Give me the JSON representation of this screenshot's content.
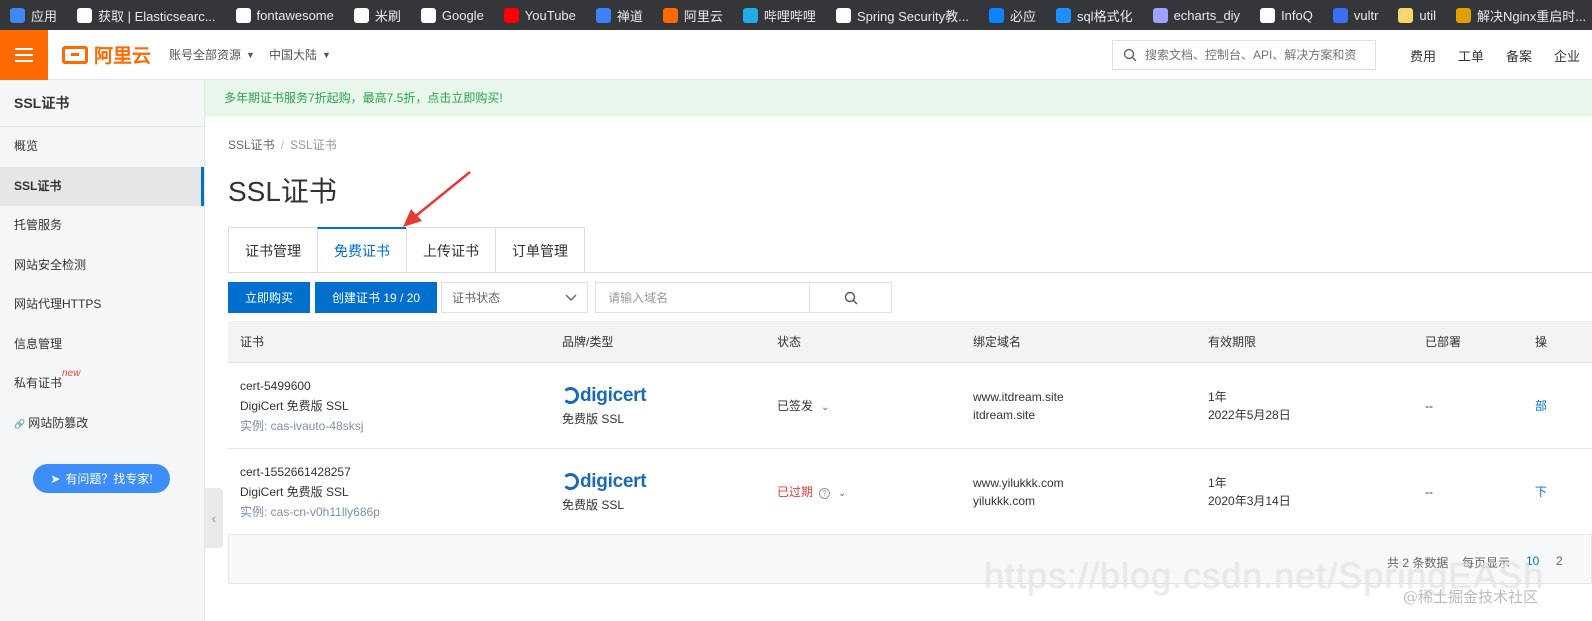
{
  "bookmarks": [
    {
      "label": "应用",
      "color": "#4285f4",
      "icon": "apps-grid-icon"
    },
    {
      "label": "获取 | Elasticsearc...",
      "color": "#ffffff",
      "icon": "elastic-icon"
    },
    {
      "label": "fontawesome",
      "color": "#ffffff",
      "icon": "globe-icon"
    },
    {
      "label": "米刷",
      "color": "#ffffff",
      "icon": "globe-icon"
    },
    {
      "label": "Google",
      "color": "#ffffff",
      "icon": "google-icon"
    },
    {
      "label": "YouTube",
      "color": "#ff0000",
      "icon": "youtube-icon"
    },
    {
      "label": "禅道",
      "color": "#3b82f6",
      "icon": "zentao-icon"
    },
    {
      "label": "阿里云",
      "color": "#ff6a00",
      "icon": "aliyun-icon"
    },
    {
      "label": "哔哩哔哩",
      "color": "#23ade5",
      "icon": "bilibili-icon"
    },
    {
      "label": "Spring Security教...",
      "color": "#ffffff",
      "icon": "bold-b-icon"
    },
    {
      "label": "必应",
      "color": "#0a84ff",
      "icon": "bing-icon"
    },
    {
      "label": "sql格式化",
      "color": "#1e90ff",
      "icon": "c-icon"
    },
    {
      "label": "echarts_diy",
      "color": "#a0a0ff",
      "icon": "echarts-icon"
    },
    {
      "label": "InfoQ",
      "color": "#ffffff",
      "icon": "infoq-icon"
    },
    {
      "label": "vultr",
      "color": "#3b6ef5",
      "icon": "vultr-icon"
    },
    {
      "label": "util",
      "color": "#f5d76e",
      "icon": "folder-icon"
    },
    {
      "label": "解决Nginx重启时...",
      "color": "#e0a000",
      "icon": "snail-icon"
    }
  ],
  "topbar": {
    "logo_text": "阿里云",
    "account_dd": "账号全部资源",
    "region_dd": "中国大陆",
    "search_placeholder": "搜索文档、控制台、API、解决方案和资",
    "links": [
      "费用",
      "工单",
      "备案",
      "企业"
    ]
  },
  "sidebar": {
    "title": "SSL证书",
    "items": [
      {
        "label": "概览"
      },
      {
        "label": "SSL证书",
        "active": true
      },
      {
        "label": "托管服务"
      },
      {
        "label": "网站安全检测"
      },
      {
        "label": "网站代理HTTPS"
      },
      {
        "label": "信息管理"
      },
      {
        "label": "私有证书",
        "tag": "new"
      },
      {
        "label": "网站防篡改"
      }
    ],
    "expert_button": "有问题？找专家!"
  },
  "promo_text": "多年期证书服务7折起购，最高7.5折，点击立即购买!",
  "breadcrumb": [
    "SSL证书",
    "SSL证书"
  ],
  "page_title": "SSL证书",
  "tabs": [
    "证书管理",
    "免费证书",
    "上传证书",
    "订单管理"
  ],
  "toolbar": {
    "buy_label": "立即购买",
    "create_label": "创建证书 19 / 20",
    "status_placeholder": "证书状态",
    "domain_placeholder": "请输入域名"
  },
  "table": {
    "columns": [
      "证书",
      "品牌/类型",
      "状态",
      "绑定域名",
      "有效期限",
      "已部署",
      "操"
    ],
    "rows": [
      {
        "name": "cert-5499600",
        "product": "DigiCert 免费版 SSL",
        "instance": "实例: cas-ivauto-48sksj",
        "brand": "digicert",
        "type": "免费版 SSL",
        "status": "已签发",
        "domains": [
          "www.itdream.site",
          "itdream.site"
        ],
        "period": "1年",
        "expiry": "2022年5月28日",
        "deployed": "--",
        "action": "部"
      },
      {
        "name": "cert-1552661428257",
        "product": "DigiCert 免费版 SSL",
        "instance": "实例: cas-cn-v0h11lly686p",
        "brand": "digicert",
        "type": "免费版 SSL",
        "status": "已过期",
        "domains": [
          "www.yilukkk.com",
          "yilukkk.com"
        ],
        "period": "1年",
        "expiry": "2020年3月14日",
        "deployed": "--",
        "action": "下"
      }
    ]
  },
  "pagination": {
    "total": "共 2 条数据",
    "per_page_label": "每页显示",
    "size_active": "10",
    "size_next": "2"
  },
  "watermark": "https://blog.csdn.net/SpringEASh",
  "juejin_mark": "@稀土掘金技术社区",
  "colors": {
    "brand_orange": "#ff6a00",
    "primary_blue": "#0070cc",
    "expired_red": "#e23c39",
    "promo_green": "#2da44e"
  }
}
